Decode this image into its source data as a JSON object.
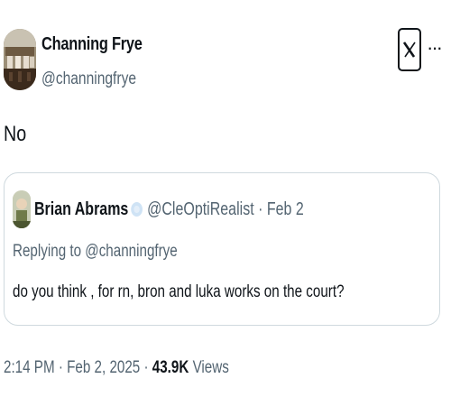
{
  "author": {
    "name": "Channing Frye",
    "handle": "@channingfrye"
  },
  "tweet": {
    "text": "No"
  },
  "quoted": {
    "name": "Brian Abrams",
    "handle": "@CleOptiRealist",
    "separator": "·",
    "date": "Feb 2",
    "replying_to": "Replying to @channingfrye",
    "text": "do you think , for rn, bron and luka works on the court?"
  },
  "footer": {
    "time": "2:14 PM",
    "date": "Feb 2, 2025",
    "separator": "·",
    "views_count": "43.9K",
    "views_label": "Views"
  },
  "icons": {
    "logo": "x-logo-icon",
    "more": "more-icon",
    "verified": "verified-badge-icon"
  },
  "colors": {
    "text": "#0f1419",
    "secondary": "#536471",
    "border": "#cfd9de",
    "badge": "#cfe3f5"
  }
}
